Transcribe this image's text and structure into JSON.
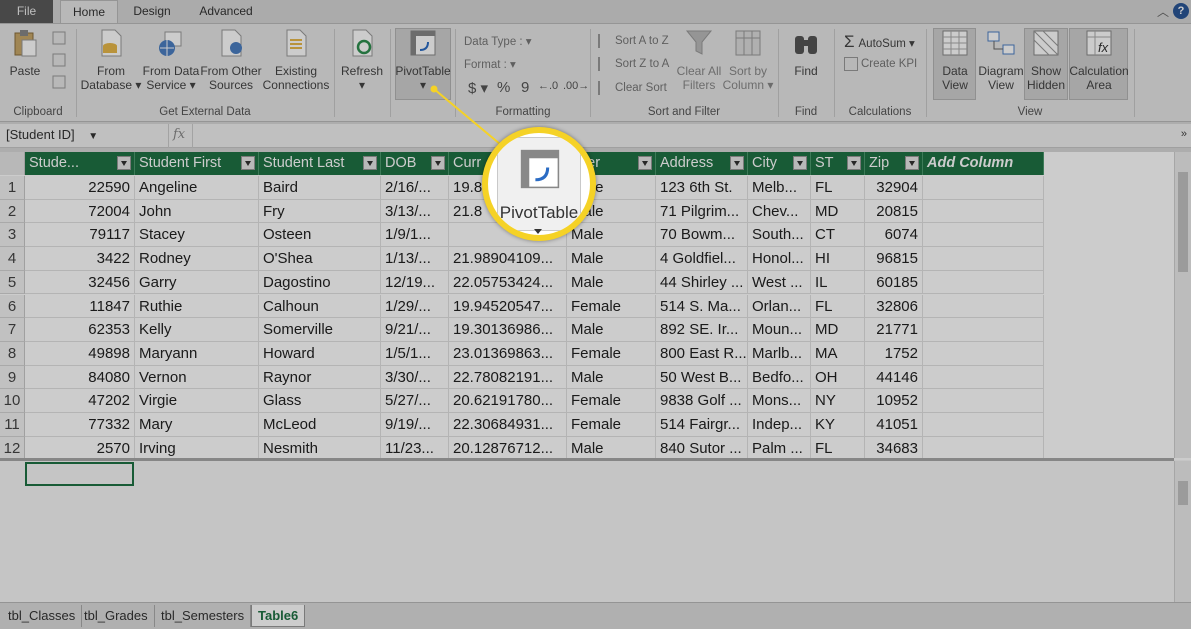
{
  "ribbon_tabs": [
    "File",
    "Home",
    "Design",
    "Advanced"
  ],
  "ribbon": {
    "clipboard": {
      "paste": "Paste",
      "group": "Clipboard"
    },
    "external": {
      "from_database": [
        "From",
        "Database ▾"
      ],
      "from_data_service": [
        "From Data",
        "Service ▾"
      ],
      "from_other_sources": [
        "From Other",
        "Sources"
      ],
      "existing_connections": [
        "Existing",
        "Connections"
      ],
      "group": "Get External Data"
    },
    "refresh": [
      "Refresh",
      "▾"
    ],
    "pivottable": [
      "PivotTable",
      "▾"
    ],
    "formatting": {
      "data_type": "Data Type :",
      "format": "Format :",
      "currency": "$",
      "percent": "%",
      "comma": "9",
      "group": "Formatting"
    },
    "sort_filter": {
      "sort_az": "Sort A to Z",
      "sort_za": "Sort Z to A",
      "clear_sort": "Clear Sort",
      "clear_all_filters": [
        "Clear All",
        "Filters"
      ],
      "sort_by_column": [
        "Sort by",
        "Column ▾"
      ],
      "group": "Sort and Filter"
    },
    "find": {
      "label": "Find",
      "group": "Find"
    },
    "calculations": {
      "autosum": "AutoSum ▾",
      "create_kpi": "Create KPI",
      "group": "Calculations"
    },
    "view": {
      "data_view": [
        "Data",
        "View"
      ],
      "diagram_view": [
        "Diagram",
        "View"
      ],
      "show_hidden": [
        "Show",
        "Hidden"
      ],
      "calculation_area": [
        "Calculation",
        "Area"
      ],
      "group": "View"
    },
    "colors": {
      "excel_green": "#1f7244",
      "callout_yellow": "#f5d226"
    }
  },
  "formula_bar": {
    "name_box": "[Student ID]",
    "fx": "fx"
  },
  "columns": [
    "Stude...",
    "Student First",
    "Student Last",
    "DOB",
    "Curr",
    "nder",
    "Address",
    "City",
    "ST",
    "Zip",
    "Add Column"
  ],
  "rows": [
    [
      "1",
      "22590",
      "Angeline",
      "Baird",
      "2/16/...",
      "19.8",
      "Male",
      "123 6th St.",
      "Melb...",
      "FL",
      "32904"
    ],
    [
      "2",
      "72004",
      "John",
      "Fry",
      "3/13/...",
      "21.8",
      "Male",
      "71 Pilgrim...",
      "Chev...",
      "MD",
      "20815"
    ],
    [
      "3",
      "79117",
      "Stacey",
      "Osteen",
      "1/9/1...",
      "",
      "Male",
      "70 Bowm...",
      "South...",
      "CT",
      "6074"
    ],
    [
      "4",
      "3422",
      "Rodney",
      "O'Shea",
      "1/13/...",
      "21.98904109...",
      "Male",
      "4 Goldfiel...",
      "Honol...",
      "HI",
      "96815"
    ],
    [
      "5",
      "32456",
      "Garry",
      "Dagostino",
      "12/19...",
      "22.05753424...",
      "Male",
      "44 Shirley ...",
      "West ...",
      "IL",
      "60185"
    ],
    [
      "6",
      "11847",
      "Ruthie",
      "Calhoun",
      "1/29/...",
      "19.94520547...",
      "Female",
      "514 S. Ma...",
      "Orlan...",
      "FL",
      "32806"
    ],
    [
      "7",
      "62353",
      "Kelly",
      "Somerville",
      "9/21/...",
      "19.30136986...",
      "Male",
      "892 SE. Ir...",
      "Moun...",
      "MD",
      "21771"
    ],
    [
      "8",
      "49898",
      "Maryann",
      "Howard",
      "1/5/1...",
      "23.01369863...",
      "Female",
      "800 East R...",
      "Marlb...",
      "MA",
      "1752"
    ],
    [
      "9",
      "84080",
      "Vernon",
      "Raynor",
      "3/30/...",
      "22.78082191...",
      "Male",
      "50 West B...",
      "Bedfo...",
      "OH",
      "44146"
    ],
    [
      "10",
      "47202",
      "Virgie",
      "Glass",
      "5/27/...",
      "20.62191780...",
      "Female",
      "9838 Golf ...",
      "Mons...",
      "NY",
      "10952"
    ],
    [
      "11",
      "77332",
      "Mary",
      "McLeod",
      "9/19/...",
      "22.30684931...",
      "Female",
      "514 Fairgr...",
      "Indep...",
      "KY",
      "41051"
    ],
    [
      "12",
      "2570",
      "Irving",
      "Nesmith",
      "11/23...",
      "20.12876712...",
      "Male",
      "840 Sutor ...",
      "Palm ...",
      "FL",
      "34683"
    ]
  ],
  "callout": {
    "label": "PivotTable",
    "arrow": "▾"
  },
  "sheet_tabs": [
    "tbl_Classes",
    "tbl_Grades",
    "tbl_Semesters",
    "Table6"
  ],
  "active_sheet": "Table6"
}
